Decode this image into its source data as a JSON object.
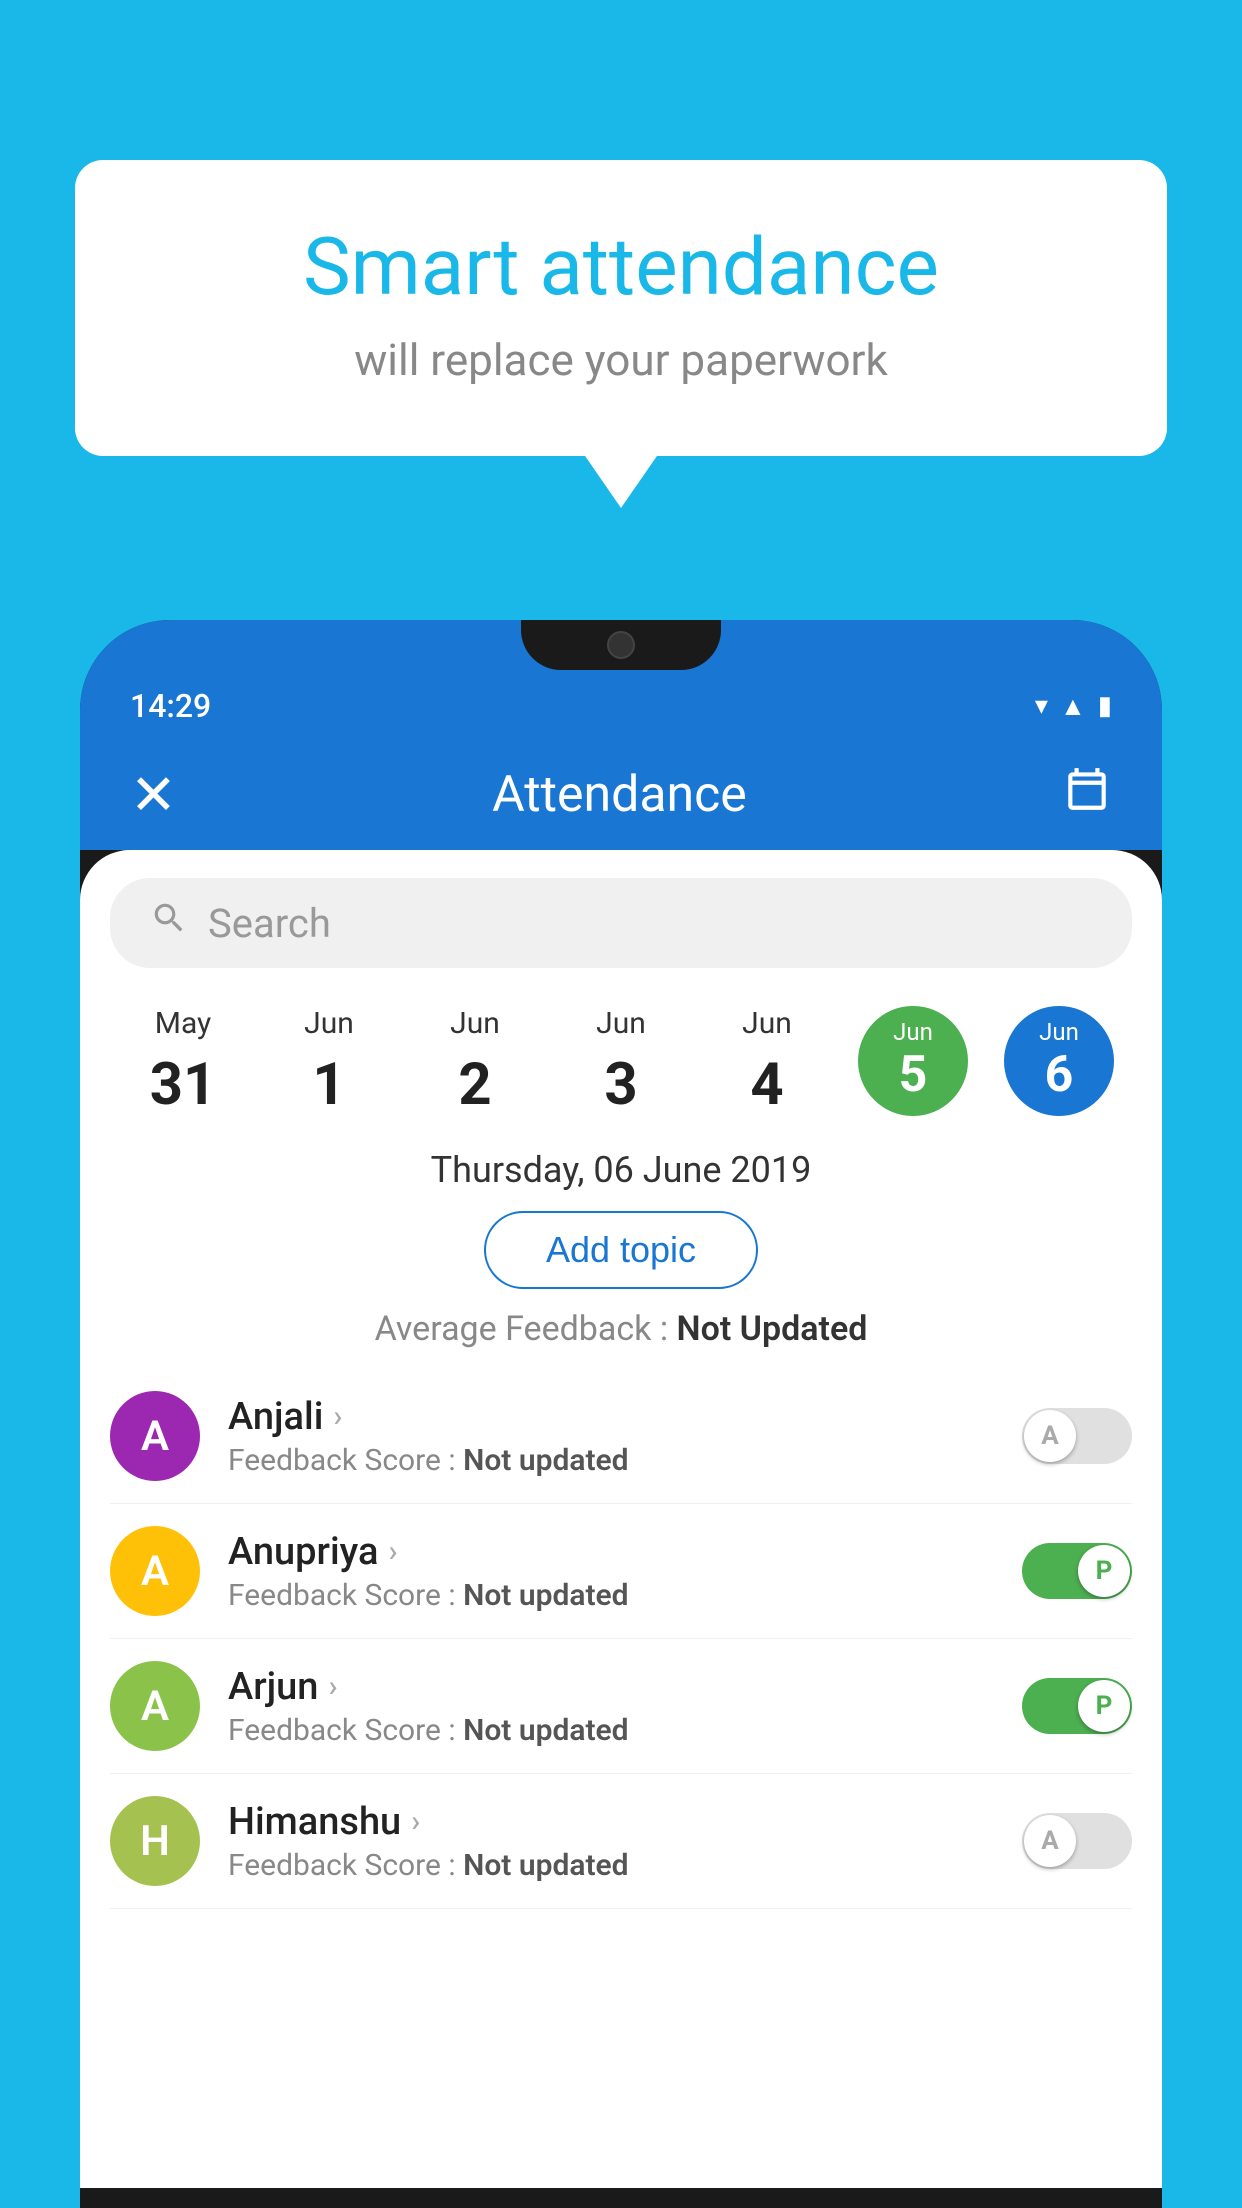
{
  "background_color": "#1ab8e8",
  "speech_bubble": {
    "headline": "Smart attendance",
    "subtext": "will replace your paperwork"
  },
  "status_bar": {
    "time": "14:29"
  },
  "top_bar": {
    "title": "Attendance",
    "close_label": "×",
    "calendar_label": "📅"
  },
  "search": {
    "placeholder": "Search"
  },
  "dates": [
    {
      "month": "May",
      "day": "31",
      "highlighted": false
    },
    {
      "month": "Jun",
      "day": "1",
      "highlighted": false
    },
    {
      "month": "Jun",
      "day": "2",
      "highlighted": false
    },
    {
      "month": "Jun",
      "day": "3",
      "highlighted": false
    },
    {
      "month": "Jun",
      "day": "4",
      "highlighted": false
    },
    {
      "month": "Jun",
      "day": "5",
      "highlighted": "green"
    },
    {
      "month": "Jun",
      "day": "6",
      "highlighted": "blue"
    }
  ],
  "selected_date_label": "Thursday, 06 June 2019",
  "add_topic_label": "Add topic",
  "avg_feedback_label": "Average Feedback :",
  "avg_feedback_value": "Not Updated",
  "students": [
    {
      "name": "Anjali",
      "avatar_letter": "A",
      "avatar_color": "purple",
      "feedback_label": "Feedback Score :",
      "feedback_value": "Not updated",
      "toggle": "off",
      "toggle_letter": "A"
    },
    {
      "name": "Anupriya",
      "avatar_letter": "A",
      "avatar_color": "yellow",
      "feedback_label": "Feedback Score :",
      "feedback_value": "Not updated",
      "toggle": "on",
      "toggle_letter": "P"
    },
    {
      "name": "Arjun",
      "avatar_letter": "A",
      "avatar_color": "green",
      "feedback_label": "Feedback Score :",
      "feedback_value": "Not updated",
      "toggle": "on",
      "toggle_letter": "P"
    },
    {
      "name": "Himanshu",
      "avatar_letter": "H",
      "avatar_color": "olive",
      "feedback_label": "Feedback Score :",
      "feedback_value": "Not updated",
      "toggle": "off",
      "toggle_letter": "A"
    }
  ]
}
